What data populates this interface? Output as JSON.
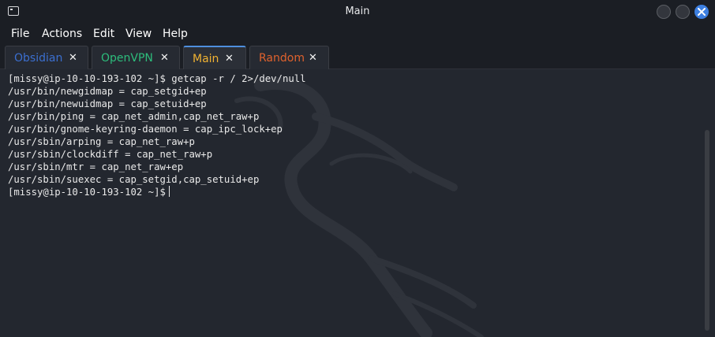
{
  "window": {
    "title": "Main"
  },
  "menubar": {
    "items": [
      "File",
      "Actions",
      "Edit",
      "View",
      "Help"
    ]
  },
  "tabs": [
    {
      "label": "Obsidian",
      "color": "#3b6fd0",
      "close": "✕"
    },
    {
      "label": "OpenVPN",
      "color": "#2dbd7c",
      "close": "✕"
    },
    {
      "label": "Main",
      "color": "#f0b232",
      "close": "✕"
    },
    {
      "label": "Random",
      "color": "#e0622d",
      "close": "✕"
    }
  ],
  "terminal": {
    "lines": [
      "[missy@ip-10-10-193-102 ~]$ getcap -r / 2>/dev/null",
      "/usr/bin/newgidmap = cap_setgid+ep",
      "/usr/bin/newuidmap = cap_setuid+ep",
      "/usr/bin/ping = cap_net_admin,cap_net_raw+p",
      "/usr/bin/gnome-keyring-daemon = cap_ipc_lock+ep",
      "/usr/sbin/arping = cap_net_raw+p",
      "/usr/sbin/clockdiff = cap_net_raw+p",
      "/usr/sbin/mtr = cap_net_raw+ep",
      "/usr/sbin/suexec = cap_setgid,cap_setuid+ep"
    ],
    "prompt": "[missy@ip-10-10-193-102 ~]$"
  },
  "icons": {
    "app": "terminal-icon",
    "close": "close-icon",
    "background": "kali-dragon-watermark"
  },
  "colors": {
    "accent": "#3d7fe0",
    "background": "#23272f"
  }
}
